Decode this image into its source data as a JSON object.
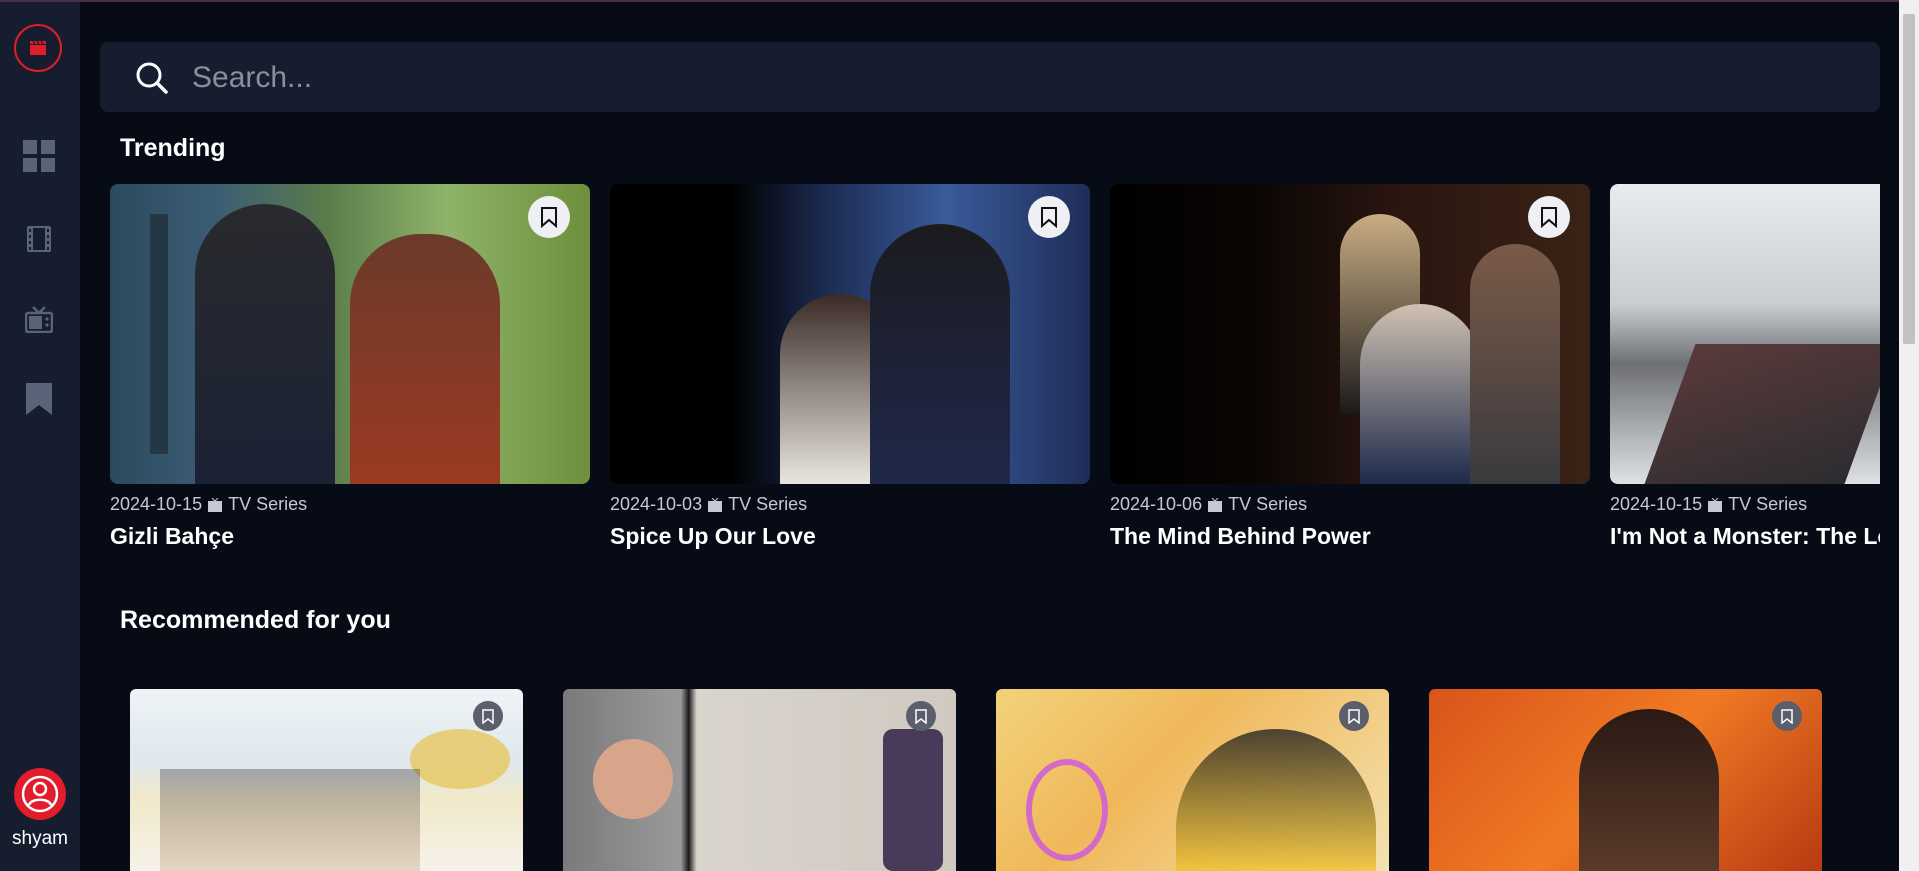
{
  "sidebar": {
    "logo": "clapperboard-icon",
    "nav": [
      {
        "icon": "grid-icon",
        "label": "Home"
      },
      {
        "icon": "film-icon",
        "label": "Movies"
      },
      {
        "icon": "tv-icon",
        "label": "TV Series"
      },
      {
        "icon": "bookmark-icon",
        "label": "Bookmarks"
      }
    ],
    "user": {
      "name": "shyam"
    }
  },
  "search": {
    "placeholder": "Search..."
  },
  "trending": {
    "title": "Trending",
    "items": [
      {
        "date": "2024-10-15",
        "type": "TV Series",
        "title": "Gizli Bahçe"
      },
      {
        "date": "2024-10-03",
        "type": "TV Series",
        "title": "Spice Up Our Love"
      },
      {
        "date": "2024-10-06",
        "type": "TV Series",
        "title": "The Mind Behind Power"
      },
      {
        "date": "2024-10-15",
        "type": "TV Series",
        "title": "I'm Not a Monster: The Lo"
      }
    ]
  },
  "recommended": {
    "title": "Recommended for you"
  },
  "colors": {
    "accent": "#e11d2b",
    "background": "#070b16",
    "panel": "#161d2f"
  }
}
